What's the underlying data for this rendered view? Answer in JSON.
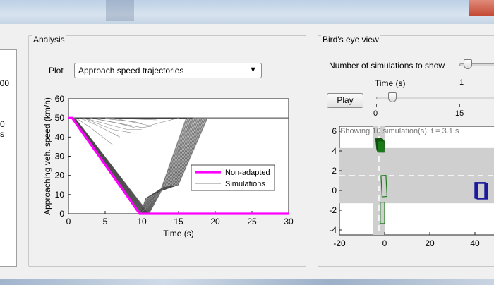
{
  "left_panel": {
    "values": [
      "00",
      "0 s"
    ]
  },
  "analysis": {
    "title": "Analysis",
    "plot_label": "Plot",
    "plot_select": "Approach speed trajectories"
  },
  "chart_data": {
    "type": "line",
    "title": "",
    "xlabel": "Time (s)",
    "ylabel": "Approaching veh. speed (km/h)",
    "xlim": [
      0,
      30
    ],
    "ylim": [
      0,
      60
    ],
    "xticks": [
      0,
      5,
      10,
      15,
      20,
      25,
      30
    ],
    "yticks": [
      0,
      10,
      20,
      30,
      40,
      50,
      60
    ],
    "grid": false,
    "legend_position": "center-right",
    "series": [
      {
        "name": "Non-adapted",
        "color": "#ff00ff",
        "x": [
          0,
          0.5,
          9.7,
          30
        ],
        "y": [
          50,
          50,
          0,
          0
        ]
      },
      {
        "name": "Simulations",
        "color": "#888888",
        "x": [
          0,
          0.6,
          9.8,
          12.5,
          17,
          30
        ],
        "y": [
          50,
          50,
          0,
          11,
          50,
          50
        ]
      }
    ],
    "reference_line": {
      "y": 50,
      "color": "#000000"
    }
  },
  "birds_eye": {
    "title": "Bird's eye view",
    "num_sims_label": "Number of simulations to show",
    "num_sims_tick": "1",
    "time_label": "Time (s)",
    "play_label": "Play",
    "time_ticks": [
      "0",
      "15"
    ],
    "view_title": "Showing 10 simulation(s); t = 3.1 s",
    "xticks": [
      "-20",
      "0",
      "20",
      "40"
    ],
    "yticks": [
      "6",
      "4",
      "2",
      "0",
      "-2",
      "-4"
    ],
    "colors": {
      "road": "#cfcfcf",
      "ego": "#1a7a1a",
      "other": "#1a1a9a"
    }
  }
}
